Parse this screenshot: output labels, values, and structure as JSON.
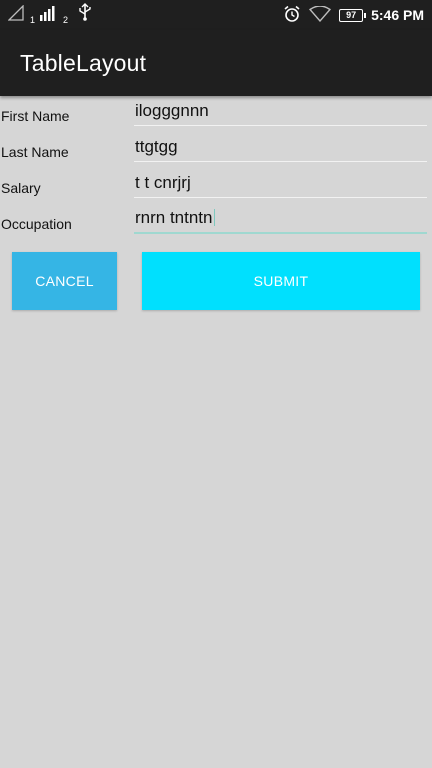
{
  "status_bar": {
    "sim1_label": "1",
    "sim2_label": "2",
    "battery_level": "97",
    "time": "5:46 PM",
    "icons": [
      "signal-empty-icon",
      "signal-bars-icon",
      "usb-icon",
      "alarm-icon",
      "wifi-icon",
      "battery-icon"
    ]
  },
  "action_bar": {
    "title": "TableLayout"
  },
  "form": {
    "rows": [
      {
        "label": "First Name",
        "value": "ilogggnnn"
      },
      {
        "label": "Last Name",
        "value": "ttgtgg"
      },
      {
        "label": "Salary",
        "value": "t t cnrjrj"
      },
      {
        "label": "Occupation",
        "value": "rnrn tntntn"
      }
    ]
  },
  "buttons": {
    "cancel_label": "CANCEL",
    "submit_label": "SUBMIT"
  },
  "colors": {
    "background": "#d6d6d6",
    "bar": "#1f1f1f",
    "cancel": "#35b5e5",
    "submit": "#00e0fe",
    "active_underline": "#9fd8d0"
  }
}
